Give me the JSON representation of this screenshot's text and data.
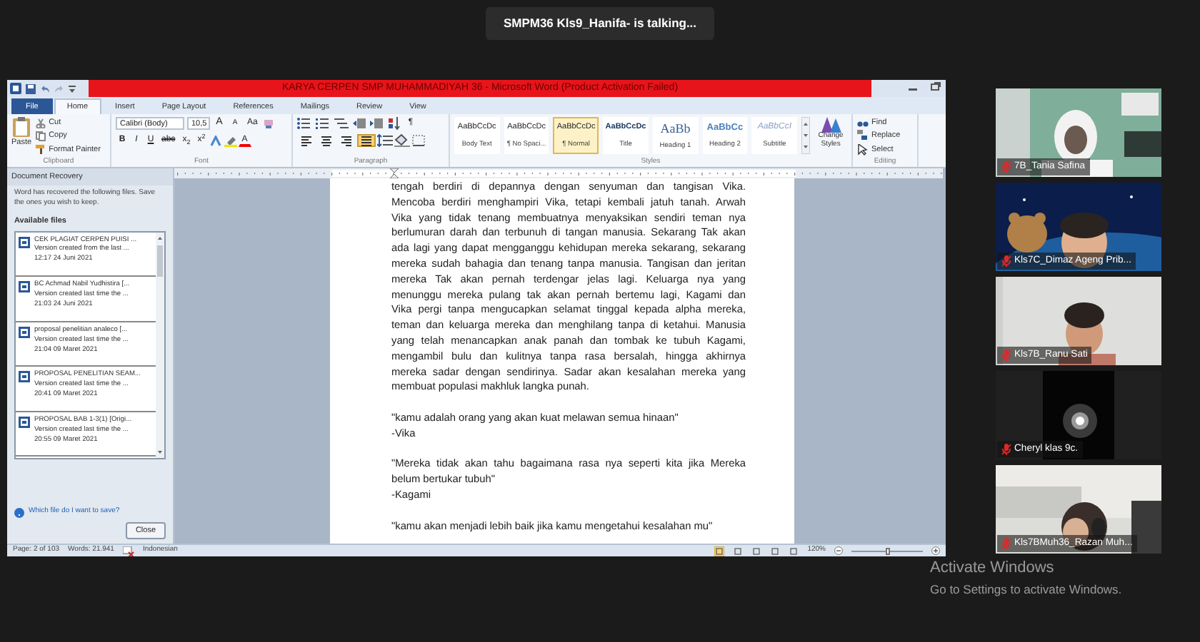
{
  "meeting": {
    "speaker_banner": "SMPM36 Kls9_Hanifa- is talking..."
  },
  "word": {
    "title": "KARYA CERPEN SMP MUHAMMADIYAH 36 - Microsoft Word (Product Activation Failed)",
    "tabs": [
      {
        "label": "File",
        "kind": "file",
        "selected": false
      },
      {
        "label": "Home",
        "kind": "tab",
        "selected": true
      },
      {
        "label": "Insert",
        "kind": "tab",
        "selected": false
      },
      {
        "label": "Page Layout",
        "kind": "tab",
        "selected": false
      },
      {
        "label": "References",
        "kind": "tab",
        "selected": false
      },
      {
        "label": "Mailings",
        "kind": "tab",
        "selected": false
      },
      {
        "label": "Review",
        "kind": "tab",
        "selected": false
      },
      {
        "label": "View",
        "kind": "tab",
        "selected": false
      }
    ],
    "ribbon": {
      "clipboard": {
        "label": "Clipboard",
        "paste": "Paste",
        "cut": "Cut",
        "copy": "Copy",
        "format_painter": "Format Painter"
      },
      "font": {
        "label": "Font",
        "name": "Calibri (Body)",
        "size": "10,5",
        "grow": "A",
        "shrink": "A",
        "change_case": "Aa",
        "font_color": "A",
        "format_buttons": [
          {
            "label": "B",
            "kind": "bold"
          },
          {
            "label": "I",
            "kind": "italic"
          },
          {
            "label": "U",
            "kind": "underline"
          },
          {
            "label": "abc",
            "kind": "strike"
          },
          {
            "label": "x$_{2}$",
            "kind": "sub"
          },
          {
            "label": "x$^{2}$",
            "kind": "sup"
          }
        ]
      },
      "paragraph": {
        "label": "Paragraph",
        "show_marks": "¶",
        "alignments": [
          {
            "kind": "left",
            "selected": false
          },
          {
            "kind": "center",
            "selected": false
          },
          {
            "kind": "right",
            "selected": false
          },
          {
            "kind": "justify",
            "selected": true
          }
        ]
      },
      "styles": {
        "label": "Styles",
        "change_styles": "Change Styles",
        "items": [
          {
            "preview": "AaBbCcDc",
            "name": "Body Text",
            "kind": "plain",
            "selected": false
          },
          {
            "preview": "AaBbCcDc",
            "name": "¶ No Spaci...",
            "kind": "plain",
            "selected": false
          },
          {
            "preview": "AaBbCcDc",
            "name": "¶ Normal",
            "kind": "plain",
            "selected": true
          },
          {
            "preview": "AaBbCcDc",
            "name": "Title",
            "kind": "title",
            "selected": false
          },
          {
            "preview": "AaBb",
            "name": "Heading 1",
            "kind": "heading1",
            "selected": false
          },
          {
            "preview": "AaBbCc",
            "name": "Heading 2",
            "kind": "heading2",
            "selected": false
          },
          {
            "preview": "AaBbCcI",
            "name": "Subtitle",
            "kind": "subtitle",
            "selected": false
          }
        ]
      },
      "editing": {
        "label": "Editing",
        "items": [
          "Find",
          "Replace",
          "Select"
        ]
      }
    },
    "recovery": {
      "title": "Document Recovery",
      "message": "Word has recovered the following files.  Save the ones you wish to keep.",
      "list_title": "Available files",
      "files": [
        {
          "name": "CEK PLAGIAT CERPEN PUISI ...",
          "detail": "Version created from the last ...",
          "time": "12:17 24 Juni 2021"
        },
        {
          "name": "BC Achmad Nabil Yudhistira  [...",
          "detail": "Version created last time the ...",
          "time": "21:03 24 Juni 2021"
        },
        {
          "name": "proposal penelitian analeco  [...",
          "detail": "Version created last time the ...",
          "time": "21:04 09 Maret 2021"
        },
        {
          "name": "PROPOSAL PENELITIAN SEAM...",
          "detail": "Version created last time the ...",
          "time": "20:41 09 Maret 2021"
        },
        {
          "name": "PROPOSAL BAB 1-3(1)  [Origi...",
          "detail": "Version created last time the ...",
          "time": "20:55 09 Maret 2021"
        }
      ],
      "help_link": "Which file do I want to save?",
      "close": "Close"
    },
    "document": {
      "blocks": [
        {
          "paragraphs": [
            {
              "lines": [
                "tengah berdiri di depannya dengan senyuman dan tangisan Vika.",
                "Mencoba berdiri menghampiri Vika, tetapi kembali jatuh tanah. Arwah",
                "Vika yang tidak tenang membuatnya menyaksikan sendiri teman nya",
                "berlumuran darah dan terbunuh di tangan manusia. Sekarang Tak akan",
                "ada lagi yang dapat mengganggu kehidupan mereka sekarang, sekarang",
                "mereka sudah bahagia dan tenang tanpa manusia. Tangisan dan jeritan",
                "mereka Tak akan pernah terdengar jelas lagi. Keluarga nya yang",
                "menunggu mereka pulang tak akan pernah bertemu lagi, Kagami dan",
                "Vika pergi tanpa mengucapkan selamat tinggal kepada alpha mereka,",
                "teman dan keluarga mereka dan menghilang tanpa di ketahui. Manusia",
                "yang telah menancapkan anak panah dan tombak ke tubuh Kagami,",
                "mengambil bulu dan kulitnya tanpa rasa bersalah, hingga akhirnya",
                "mereka sadar dengan sendirinya. Sadar akan kesalahan mereka yang",
                "membuat populasi makhluk langka punah."
              ]
            }
          ]
        },
        {
          "paragraphs": [
            {
              "lines": [
                "\"kamu adalah orang yang akan kuat melawan semua hinaan\""
              ]
            },
            {
              "lines": [
                "-Vika"
              ]
            }
          ]
        },
        {
          "paragraphs": [
            {
              "lines": [
                "\"Mereka tidak akan tahu bagaimana rasa nya seperti kita jika Mereka",
                "belum bertukar tubuh\""
              ]
            },
            {
              "lines": [
                "-Kagami"
              ]
            }
          ]
        },
        {
          "paragraphs": [
            {
              "lines": [
                "\"kamu akan menjadi lebih baik jika kamu mengetahui kesalahan mu\""
              ]
            }
          ]
        }
      ]
    },
    "status": {
      "page": "Page: 2 of 103",
      "words": "Words: 21.941",
      "language": "Indonesian",
      "zoom": "120%",
      "zoom_slider": {
        "level": 0.5
      }
    }
  },
  "participants": [
    {
      "name": "7B_Tania Safina",
      "muted": true
    },
    {
      "name": "Kls7C_Dimaz Ageng Prib...",
      "muted": true
    },
    {
      "name": "Kls7B_Ranu Sati",
      "muted": true
    },
    {
      "name": "Cheryl klas 9c.",
      "muted": true
    },
    {
      "name": "Kls7BMuh36_Razan Muh...",
      "muted": true
    }
  ],
  "activation": {
    "title": "Activate Windows",
    "detail": "Go to Settings to activate Windows."
  }
}
